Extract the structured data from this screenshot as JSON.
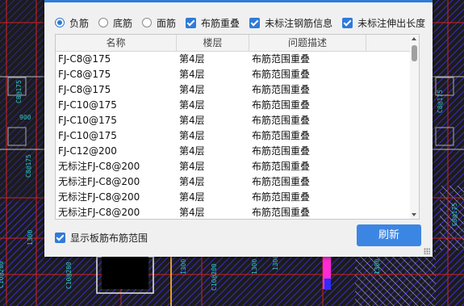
{
  "options": [
    {
      "type": "radio",
      "label": "负筋",
      "checked": true
    },
    {
      "type": "radio",
      "label": "底筋",
      "checked": false
    },
    {
      "type": "radio",
      "label": "面筋",
      "checked": false
    },
    {
      "type": "checkbox",
      "label": "布筋重叠",
      "checked": true
    },
    {
      "type": "checkbox",
      "label": "未标注钢筋信息",
      "checked": true
    },
    {
      "type": "checkbox",
      "label": "未标注伸出长度",
      "checked": true
    }
  ],
  "table": {
    "columns": [
      "名称",
      "楼层",
      "问题描述"
    ],
    "rows": [
      [
        "FJ-C8@175",
        "第4层",
        "布筋范围重叠"
      ],
      [
        "FJ-C8@175",
        "第4层",
        "布筋范围重叠"
      ],
      [
        "FJ-C8@175",
        "第4层",
        "布筋范围重叠"
      ],
      [
        "FJ-C10@175",
        "第4层",
        "布筋范围重叠"
      ],
      [
        "FJ-C10@175",
        "第4层",
        "布筋范围重叠"
      ],
      [
        "FJ-C10@175",
        "第4层",
        "布筋范围重叠"
      ],
      [
        "FJ-C12@200",
        "第4层",
        "布筋范围重叠"
      ],
      [
        "无标注FJ-C8@200",
        "第4层",
        "布筋范围重叠"
      ],
      [
        "无标注FJ-C8@200",
        "第4层",
        "布筋范围重叠"
      ],
      [
        "无标注FJ-C8@200",
        "第4层",
        "布筋范围重叠"
      ],
      [
        "无标注FJ-C8@200",
        "第4层",
        "布筋范围重叠"
      ]
    ]
  },
  "footer": {
    "show_range_label": "显示板筋布筋范围",
    "show_range_checked": true,
    "refresh_label": "刷新"
  },
  "background_labels": [
    "C8@175",
    "900",
    "C8@175",
    "C10@200",
    "C8@175",
    "1300",
    "1300",
    "C10@200",
    "1300",
    "C10@200",
    "C8@175",
    "1300",
    "1300"
  ]
}
